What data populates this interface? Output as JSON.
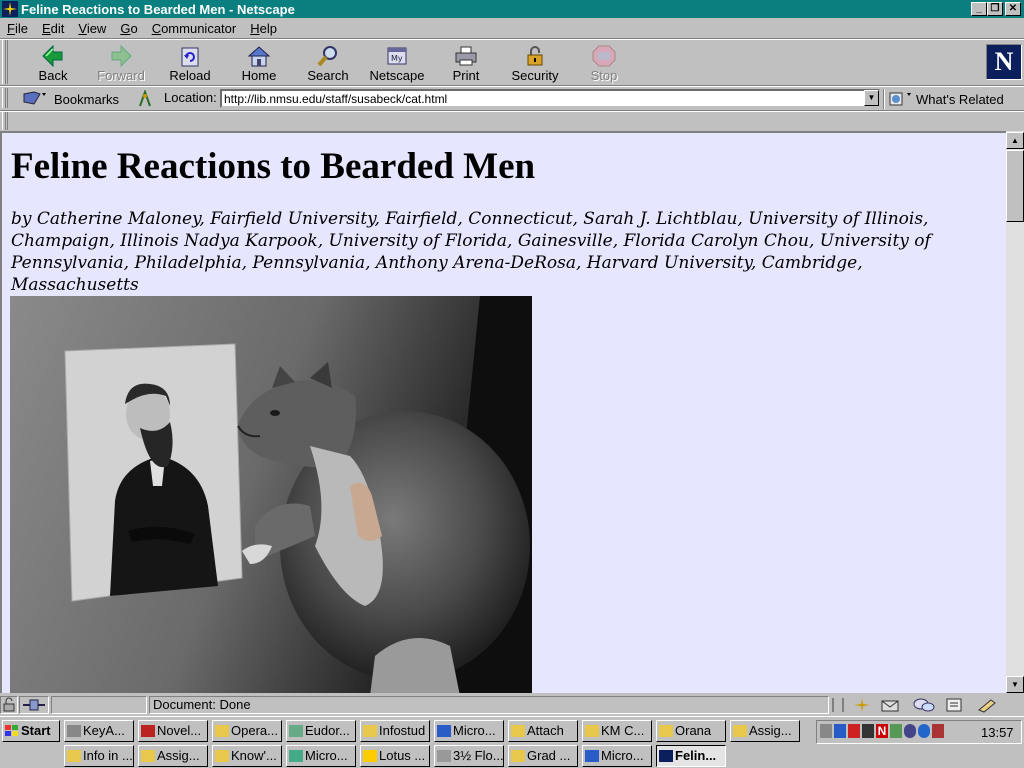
{
  "window": {
    "title": "Feline Reactions to Bearded Men - Netscape"
  },
  "menu": [
    {
      "label": "File",
      "u": "F",
      "rest": "ile"
    },
    {
      "label": "Edit",
      "u": "E",
      "rest": "dit"
    },
    {
      "label": "View",
      "u": "V",
      "rest": "iew"
    },
    {
      "label": "Go",
      "u": "G",
      "rest": "o"
    },
    {
      "label": "Communicator",
      "u": "C",
      "rest": "ommunicator"
    },
    {
      "label": "Help",
      "u": "H",
      "rest": "elp"
    }
  ],
  "toolbar": {
    "back": "Back",
    "forward": "Forward",
    "reload": "Reload",
    "home": "Home",
    "search": "Search",
    "netscape": "Netscape",
    "print": "Print",
    "security": "Security",
    "stop": "Stop"
  },
  "locationbar": {
    "bookmarks": "Bookmarks",
    "location_label": "Location:",
    "url": "http://lib.nmsu.edu/staff/susabeck/cat.html",
    "whats_related": "What's Related"
  },
  "page": {
    "title": "Feline Reactions to Bearded Men",
    "authors": "by Catherine Maloney, Fairfield University, Fairfield, Connecticut, Sarah J. Lichtblau, University of Illinois, Champaign, Illinois Nadya Karpook, University of Florida, Gainesville, Florida Carolyn Chou, University of Pennsylvania, Philadelphia, Pennsylvania, Anthony Arena-DeRosa, Harvard University, Cambridge, Massachusetts"
  },
  "status": {
    "text": "Document: Done"
  },
  "taskbar": {
    "start": "Start",
    "row1": [
      "KeyA...",
      "Novel...",
      "Opera...",
      "Eudor...",
      "Infostud",
      "Micro...",
      "Attach",
      "KM C...",
      "Orana",
      "Assig..."
    ],
    "row2": [
      "Info in ...",
      "Assig...",
      "Know'...",
      "Micro...",
      "Lotus ...",
      "3½ Flo...",
      "Grad ...",
      "Micro...",
      "Felin..."
    ],
    "clock": "13:57"
  }
}
